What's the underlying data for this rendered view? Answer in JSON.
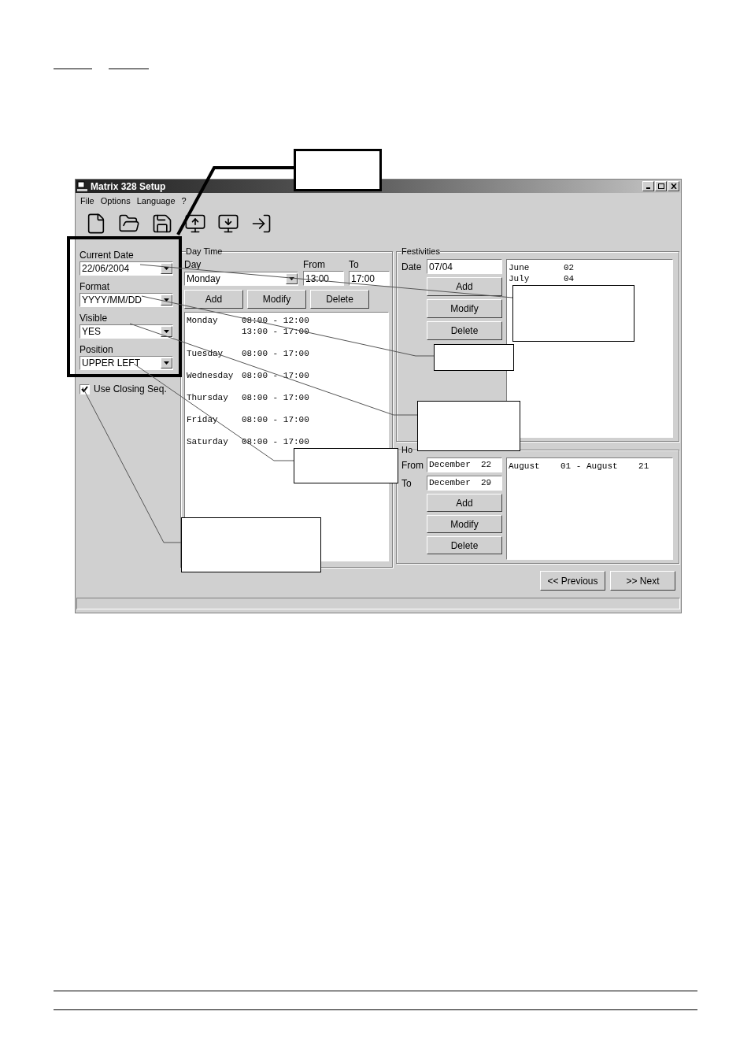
{
  "window": {
    "title": "Matrix 328 Setup"
  },
  "menu": [
    "File",
    "Options",
    "Language",
    "?"
  ],
  "display": {
    "fields": [
      {
        "label": "Current Date",
        "value": "22/06/2004"
      },
      {
        "label": "Format",
        "value": "YYYY/MM/DD"
      },
      {
        "label": "Visible",
        "value": "YES"
      },
      {
        "label": "Position",
        "value": "UPPER LEFT"
      }
    ],
    "closing_seq": {
      "label": "Use Closing Seq.",
      "checked": true
    }
  },
  "day_time": {
    "title": "Day Time",
    "day_label": "Day",
    "day_value": "Monday",
    "from_label": "From",
    "from_value": "13:00",
    "to_label": "To",
    "to_value": "17:00",
    "buttons": [
      "Add",
      "Modify",
      "Delete"
    ],
    "schedule": [
      {
        "day": "Monday",
        "ranges": [
          "08:00 - 12:00",
          "13:00 - 17:00"
        ]
      },
      {
        "day": "Tuesday",
        "ranges": [
          "08:00 - 17:00"
        ]
      },
      {
        "day": "Wednesday",
        "ranges": [
          "08:00 - 17:00"
        ]
      },
      {
        "day": "Thursday",
        "ranges": [
          "08:00 - 17:00"
        ]
      },
      {
        "day": "Friday",
        "ranges": [
          "08:00 - 17:00"
        ]
      },
      {
        "day": "Saturday",
        "ranges": [
          "08:00 - 17:00"
        ]
      }
    ]
  },
  "festivities": {
    "title": "Festivities",
    "date_label": "Date",
    "date_value": "07/04",
    "buttons": [
      "Add",
      "Modify",
      "Delete"
    ],
    "list": [
      {
        "month": "June",
        "day": "02"
      },
      {
        "month": "July",
        "day": "04"
      }
    ]
  },
  "holiday": {
    "title": "Ho",
    "from_label": "From",
    "from_value": "December  22",
    "to_label": "To",
    "to_value": "December  29",
    "buttons": [
      "Add",
      "Modify",
      "Delete"
    ],
    "list": [
      "August    01 - August    21"
    ]
  },
  "navigation": [
    "<< Previous",
    ">> Next"
  ]
}
